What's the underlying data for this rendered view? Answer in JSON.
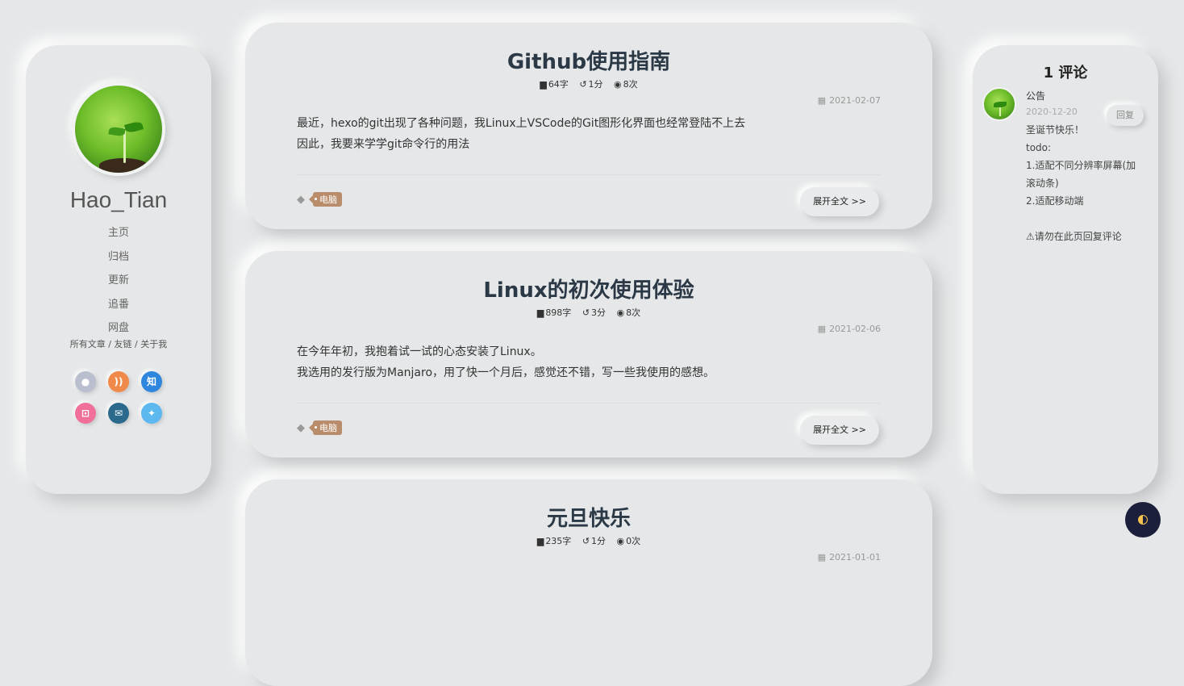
{
  "profile": {
    "name": "Hao_Tian",
    "nav": [
      "主页",
      "归档",
      "更新",
      "追番",
      "网盘"
    ],
    "links": [
      "所有文章",
      "友链",
      "关于我"
    ],
    "link_sep": " / ",
    "socials": [
      {
        "name": "github",
        "glyph": "●",
        "color": "#b9bfcf"
      },
      {
        "name": "rss",
        "glyph": "))",
        "color": "#f08a4b"
      },
      {
        "name": "zhihu",
        "glyph": "知",
        "color": "#2e86de"
      },
      {
        "name": "bilibili",
        "glyph": "⊡",
        "color": "#f0709a"
      },
      {
        "name": "email",
        "glyph": "✉",
        "color": "#2b6a8c"
      },
      {
        "name": "twitter",
        "glyph": "✦",
        "color": "#5cb8ee"
      }
    ]
  },
  "posts": [
    {
      "title": "Github使用指南",
      "words": "64字",
      "time": "1分",
      "views": "8次",
      "date": "2021-02-07",
      "excerpt": [
        "最近，hexo的git出现了各种问题，我Linux上VSCode的Git图形化界面也经常登陆不上去",
        "因此，我要来学学git命令行的用法"
      ],
      "tag": "电脑",
      "read_more": "展开全文 >>"
    },
    {
      "title": "Linux的初次使用体验",
      "words": "898字",
      "time": "3分",
      "views": "8次",
      "date": "2021-02-06",
      "excerpt": [
        "在今年年初，我抱着试一试的心态安装了Linux。",
        "我选用的发行版为Manjaro，用了快一个月后，感觉还不错，写一些我使用的感想。"
      ],
      "tag": "电脑",
      "read_more": "展开全文 >>"
    },
    {
      "title": "元旦快乐",
      "words": "235字",
      "time": "1分",
      "views": "0次",
      "date": "2021-01-01",
      "excerpt": [],
      "tag": "",
      "read_more": ""
    }
  ],
  "comments": {
    "title": "1 评论",
    "author": "公告",
    "date": "2020-12-20",
    "reply": "回复",
    "body": [
      "圣诞节快乐！",
      "todo:",
      "1.适配不同分辨率屏幕(加",
      "滚动条)",
      "2.适配移动端",
      "",
      "⚠请勿在此页回复评论"
    ]
  },
  "colors": {
    "background": "#e5e7e8",
    "title": "#2b3845",
    "tag": "#b98d6c",
    "dark_toggle": "#1c1f3b"
  }
}
